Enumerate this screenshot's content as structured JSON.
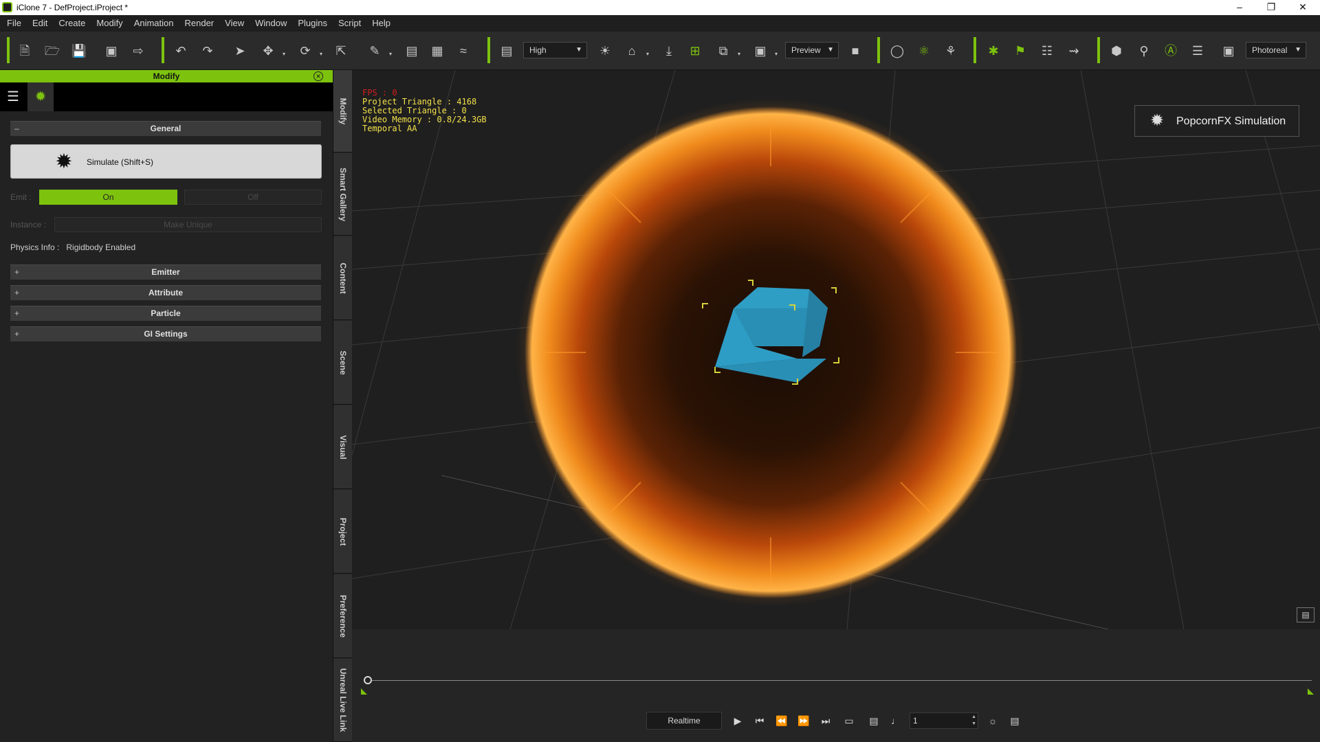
{
  "window": {
    "title": "iClone 7 - DefProject.iProject *"
  },
  "menu": [
    "File",
    "Edit",
    "Create",
    "Modify",
    "Animation",
    "Render",
    "View",
    "Window",
    "Plugins",
    "Script",
    "Help"
  ],
  "toolbar": {
    "quality_value": "High",
    "preview_value": "Preview",
    "render_mode_value": "Photoreal",
    "accent_color": "#7dc30e"
  },
  "panel": {
    "title": "Modify",
    "general_label": "General",
    "simulate_label": "Simulate (Shift+S)",
    "emit_label": "Emit :",
    "emit_on": "On",
    "emit_off": "Off",
    "instance_label": "Instance :",
    "make_unique": "Make Unique",
    "physics_label": "Physics Info :",
    "physics_value": "Rigidbody Enabled",
    "sections": [
      "Emitter",
      "Attribute",
      "Particle",
      "GI Settings"
    ]
  },
  "side_tabs": [
    "Modify",
    "Smart Gallery",
    "Content",
    "Scene",
    "Visual",
    "Project",
    "Preference",
    "Unreal Live Link"
  ],
  "viewport": {
    "fps": "FPS : 0",
    "project_triangle": "Project Triangle : 4168",
    "selected_triangle": "Selected Triangle : 0",
    "video_memory": "Video Memory : 0.8/24.3GB",
    "aa_mode": "Temporal AA",
    "badge_label": "PopcornFX Simulation"
  },
  "timeline": {
    "realtime_label": "Realtime",
    "current_frame": "1"
  }
}
